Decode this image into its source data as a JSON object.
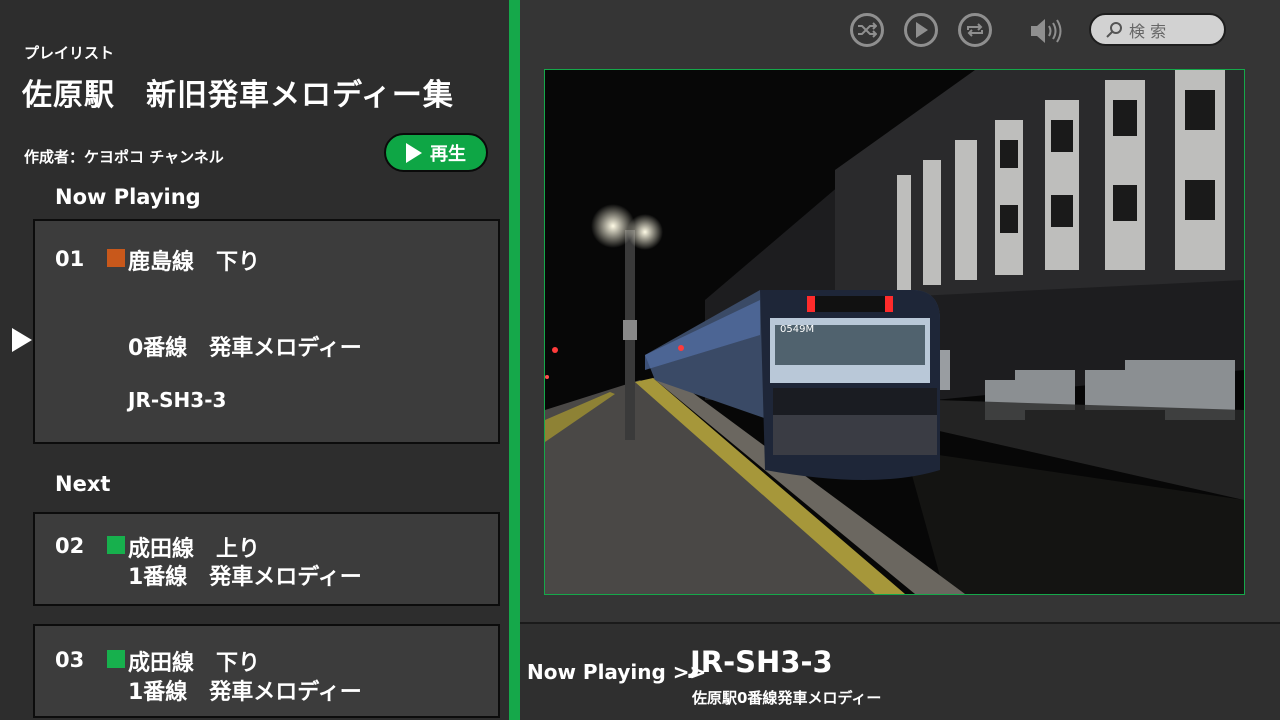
{
  "playlist": {
    "label": "プレイリスト",
    "title": "佐原駅　新旧発車メロディー集",
    "creator": "作成者：ケヨポコ チャンネル",
    "play_label": "再生"
  },
  "sections": {
    "now_playing": "Now Playing",
    "next": "Next"
  },
  "tracks": [
    {
      "num": "01",
      "line": "鹿島線　下り",
      "platform": "0番線　発車メロディー",
      "code": "JR-SH3-3",
      "color": "#c8581b"
    },
    {
      "num": "02",
      "line": "成田線　上り",
      "platform": "1番線　発車メロディー",
      "color": "#17b04d"
    },
    {
      "num": "03",
      "line": "成田線　下り",
      "platform": "1番線　発車メロディー",
      "color": "#17b04d"
    }
  ],
  "controls": {
    "icons": [
      "shuffle-icon",
      "play-icon",
      "repeat-icon",
      "volume-icon"
    ]
  },
  "search": {
    "placeholder": "検 索"
  },
  "now_playing_bar": {
    "label": "Now Playing  >>",
    "title": "JR-SH3-3",
    "subtitle": "佐原駅0番線発車メロディー"
  },
  "photo": {
    "train_display": "0549M"
  },
  "colors": {
    "accent": "#15a84a",
    "panel": "#2d2d2d",
    "card": "#3c3c3c"
  }
}
